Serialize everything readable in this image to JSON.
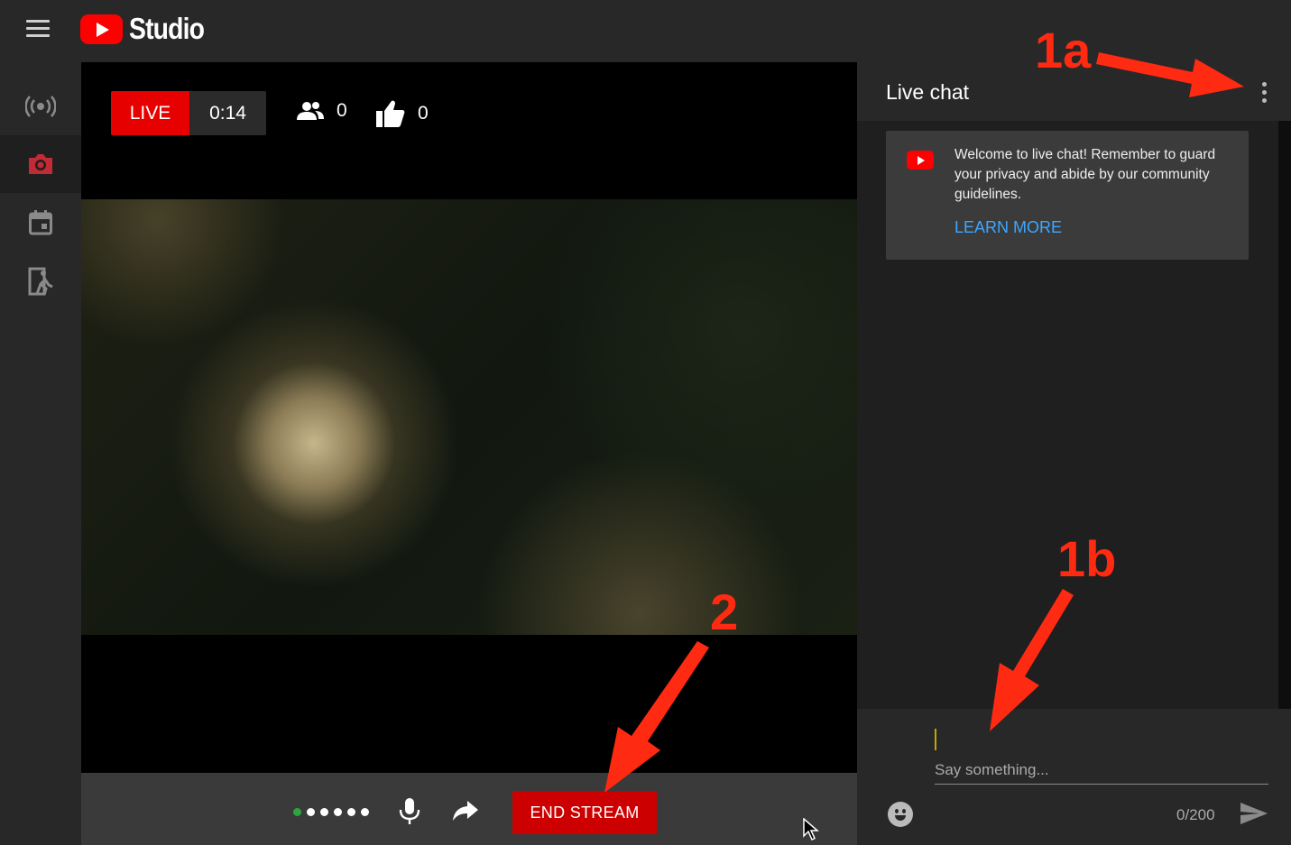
{
  "app": {
    "logo_text": "Studio"
  },
  "sidebar": {
    "items": [
      {
        "name": "stream",
        "icon": "broadcast-icon"
      },
      {
        "name": "webcam",
        "icon": "camera-icon",
        "active": true
      },
      {
        "name": "schedule",
        "icon": "calendar-icon"
      },
      {
        "name": "manage",
        "icon": "manage-icon"
      }
    ]
  },
  "stream": {
    "live_label": "LIVE",
    "elapsed": "0:14",
    "viewers": "0",
    "likes": "0"
  },
  "controls": {
    "end_stream_label": "END STREAM",
    "audio_level_dots": 6
  },
  "chat": {
    "title": "Live chat",
    "welcome_message": "Welcome to live chat! Remember to guard your privacy and abide by our community guidelines.",
    "learn_more_label": "LEARN MORE",
    "input_placeholder": "Say something...",
    "char_count": "0/200"
  },
  "annotations": {
    "label_1a": "1a",
    "label_1b": "1b",
    "label_2": "2"
  },
  "colors": {
    "live_red": "#e60000",
    "end_stream_red": "#cc0000",
    "link_blue": "#3ea6ff",
    "annotation_red": "#ff2a12",
    "audio_active_green": "#2ba640"
  }
}
